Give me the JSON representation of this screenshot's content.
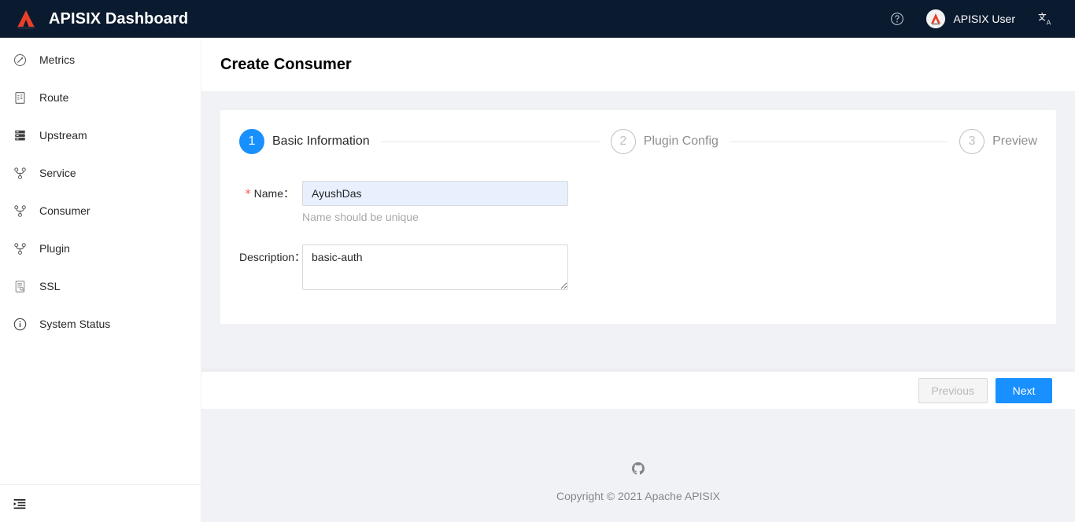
{
  "header": {
    "brand_title": "APISIX Dashboard",
    "logo_alt": "apisix-logo",
    "help_icon": "question-circle-icon",
    "user_name": "APISIX User",
    "lang_icon": "language-switch-icon"
  },
  "sidebar": {
    "items": [
      {
        "label": "Metrics",
        "icon": "dashboard-icon"
      },
      {
        "label": "Route",
        "icon": "route-form-icon"
      },
      {
        "label": "Upstream",
        "icon": "server-stack-icon"
      },
      {
        "label": "Service",
        "icon": "branch-nodes-icon"
      },
      {
        "label": "Consumer",
        "icon": "branch-nodes-icon"
      },
      {
        "label": "Plugin",
        "icon": "branch-nodes-icon"
      },
      {
        "label": "SSL",
        "icon": "certificate-icon"
      },
      {
        "label": "System Status",
        "icon": "info-circle-icon"
      }
    ],
    "collapse_icon": "menu-fold-icon"
  },
  "page": {
    "title": "Create Consumer"
  },
  "steps": [
    {
      "number": "1",
      "label": "Basic Information",
      "state": "active"
    },
    {
      "number": "2",
      "label": "Plugin Config",
      "state": "wait"
    },
    {
      "number": "3",
      "label": "Preview",
      "state": "wait"
    }
  ],
  "form": {
    "name": {
      "required_mark": "*",
      "label": "Name：",
      "value": "AyushDas",
      "placeholder": "",
      "help": "Name should be unique"
    },
    "description": {
      "label": "Description：",
      "value": "basic-auth",
      "placeholder": ""
    }
  },
  "actions": {
    "previous_label": "Previous",
    "next_label": "Next"
  },
  "footer": {
    "github_icon": "github-icon",
    "copyright": "Copyright © 2021 Apache APISIX"
  },
  "colors": {
    "header_bg": "#0a1a2f",
    "primary": "#1890ff",
    "page_bg": "#f0f2f5",
    "required_star": "#ff4d4f",
    "logo_red": "#e8402a",
    "autofill_bg": "#e8f0fe"
  }
}
